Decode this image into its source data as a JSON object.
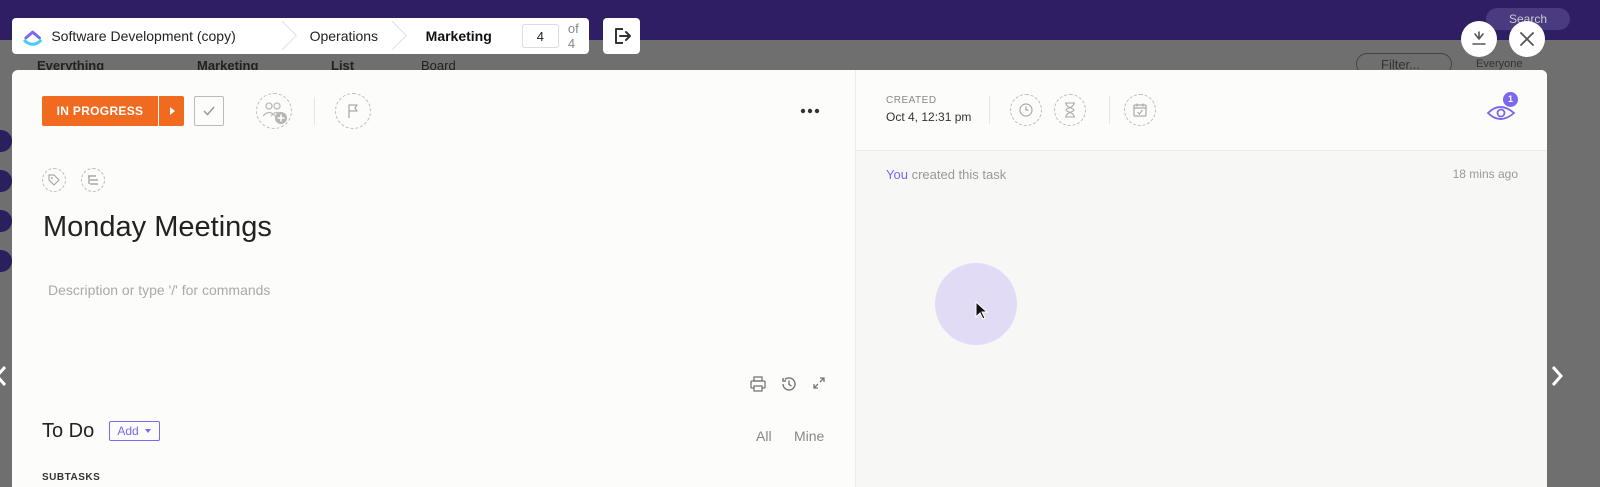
{
  "breadcrumb": {
    "items": [
      "Software Development (copy)",
      "Operations",
      "Marketing"
    ],
    "current_page": "4",
    "page_total": "of 4"
  },
  "background": {
    "everything": "Everything",
    "list_name": "Marketing",
    "view_list": "List",
    "view_board": "Board",
    "search": "Search",
    "filter": "Filter...",
    "everyone": "Everyone"
  },
  "task": {
    "status": "IN PROGRESS",
    "title": "Monday Meetings",
    "description_placeholder": "Description or type '/' for commands",
    "todo_label": "To Do",
    "add_label": "Add",
    "filter_all": "All",
    "filter_mine": "Mine",
    "subtasks_label": "SUBTASKS"
  },
  "details": {
    "created_label": "CREATED",
    "created_value": "Oct 4, 12:31 pm",
    "watchers_count": "1"
  },
  "activity": {
    "actor": "You",
    "action": "created this task",
    "time": "18 mins ago"
  },
  "colors": {
    "status": "#f06a20",
    "accent": "#7b68ee",
    "topbar": "#2f1e63"
  },
  "icons": [
    "clickup-logo-icon",
    "exit-icon",
    "minimize-icon",
    "close-icon",
    "check-icon",
    "assignee-add-icon",
    "flag-icon",
    "more-icon",
    "tag-icon",
    "subtask-icon",
    "print-icon",
    "history-icon",
    "expand-icon",
    "timer-icon",
    "hourglass-icon",
    "calendar-icon",
    "eye-icon",
    "chevron-left-icon",
    "chevron-right-icon",
    "cursor-icon"
  ]
}
